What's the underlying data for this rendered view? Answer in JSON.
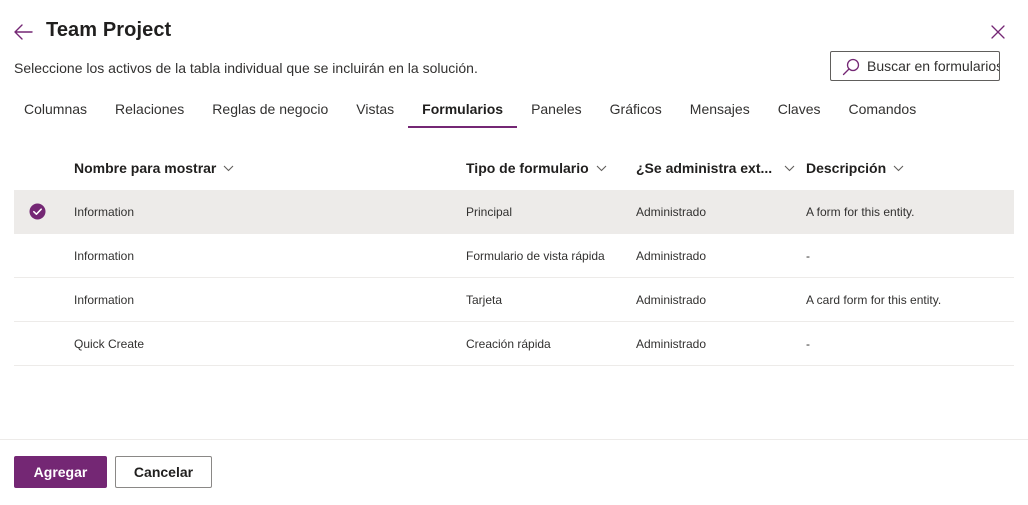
{
  "header": {
    "title": "Team Project",
    "subtitle": "Seleccione los activos de la tabla individual que se incluirán en la solución.",
    "back_icon": "arrow-left-icon",
    "close_icon": "close-icon"
  },
  "search": {
    "placeholder": "Buscar en formularios",
    "icon": "search-icon"
  },
  "tabs": [
    {
      "label": "Columnas",
      "active": false
    },
    {
      "label": "Relaciones",
      "active": false
    },
    {
      "label": "Reglas de negocio",
      "active": false
    },
    {
      "label": "Vistas",
      "active": false
    },
    {
      "label": "Formularios",
      "active": true
    },
    {
      "label": "Paneles",
      "active": false
    },
    {
      "label": "Gráficos",
      "active": false
    },
    {
      "label": "Mensajes",
      "active": false
    },
    {
      "label": "Claves",
      "active": false
    },
    {
      "label": "Comandos",
      "active": false
    }
  ],
  "table": {
    "columns": [
      "Nombre para mostrar",
      "Tipo de formulario",
      "¿Se administra ext...",
      "Descripción"
    ],
    "rows": [
      {
        "selected": true,
        "cells": [
          "Information",
          "Principal",
          "Administrado",
          "A form for this entity."
        ]
      },
      {
        "selected": false,
        "cells": [
          "Information",
          "Formulario de vista rápida",
          "Administrado",
          "-"
        ]
      },
      {
        "selected": false,
        "cells": [
          "Information",
          "Tarjeta",
          "Administrado",
          "A card form for this entity."
        ]
      },
      {
        "selected": false,
        "cells": [
          "Quick Create",
          "Creación rápida",
          "Administrado",
          "-"
        ]
      }
    ]
  },
  "footer": {
    "add_label": "Agregar",
    "cancel_label": "Cancelar"
  },
  "colors": {
    "accent": "#742774",
    "selected_row": "#edebe9",
    "divider": "#edebe9",
    "text": "#323130"
  }
}
